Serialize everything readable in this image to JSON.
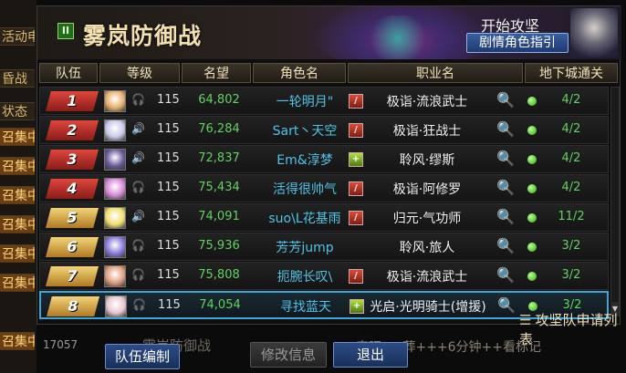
{
  "background": {
    "left_tags": [
      {
        "text": "活动申窗",
        "style": "dark"
      },
      {
        "text": "昏战",
        "style": "dark"
      },
      {
        "text": "状态",
        "style": "dark"
      },
      {
        "text": "召集中",
        "style": "orange"
      },
      {
        "text": "召集中",
        "style": "orange"
      },
      {
        "text": "召集中",
        "style": "orange"
      },
      {
        "text": "召集中",
        "style": "orange"
      },
      {
        "text": "召集中",
        "style": "orange"
      },
      {
        "text": "召集中",
        "style": "orange"
      },
      {
        "text": "召集中",
        "style": "orange"
      }
    ],
    "footer_number": "17057",
    "footer_title": "雾岚防御战",
    "footer_note": "来吧++葬+++6分钟++看标记"
  },
  "window": {
    "title": "雾岚防御战",
    "title_icon": "pause-icon",
    "start_label": "开始攻坚",
    "guide_button": "剧情角色指引"
  },
  "table": {
    "columns": [
      "队伍",
      "等级",
      "名望",
      "角色名",
      "职业名",
      "地下城通关"
    ],
    "rows": [
      {
        "rank": "1",
        "rank_color": "red",
        "avatar_color": "#e8b070",
        "sound": "🎧",
        "level": "115",
        "fame": "64,802",
        "name": "一轮明月\"",
        "class_icon": "warrior",
        "class_name": "极诣·流浪武士",
        "clear": "4/2"
      },
      {
        "rank": "2",
        "rank_color": "red",
        "avatar_color": "#c8c8e8",
        "sound": "🔊",
        "level": "115",
        "fame": "76,284",
        "name": "Sart丶天空",
        "class_icon": "warrior",
        "class_name": "极诣·狂战士",
        "clear": "4/2"
      },
      {
        "rank": "3",
        "rank_color": "red",
        "avatar_color": "#6a5a9a",
        "sound": "🔊",
        "level": "115",
        "fame": "72,837",
        "name": "Em&淳梦",
        "class_icon": "priest",
        "class_name": "聆风·缪斯",
        "clear": "4/2"
      },
      {
        "rank": "4",
        "rank_color": "red",
        "avatar_color": "#d88ad8",
        "sound": "🎧",
        "level": "115",
        "fame": "75,434",
        "name": "活得很帅气",
        "class_icon": "warrior",
        "class_name": "极诣·阿修罗",
        "clear": "4/2"
      },
      {
        "rank": "5",
        "rank_color": "gold",
        "avatar_color": "#f0e070",
        "sound": "🔊",
        "level": "115",
        "fame": "74,091",
        "name": "suo\\L花基雨",
        "class_icon": "warrior",
        "class_name": "归元·气功师",
        "clear": "11/2"
      },
      {
        "rank": "6",
        "rank_color": "gold",
        "avatar_color": "#8a7ad8",
        "sound": "🎧",
        "level": "115",
        "fame": "75,936",
        "name": "芳芳jump",
        "class_icon": "",
        "class_name": "聆风·旅人",
        "clear": "3/2"
      },
      {
        "rank": "7",
        "rank_color": "gold",
        "avatar_color": "#e0a080",
        "sound": "🎧",
        "level": "115",
        "fame": "75,808",
        "name": "扼腕长叹\\",
        "class_icon": "warrior",
        "class_name": "极诣·流浪武士",
        "clear": "3/2"
      },
      {
        "rank": "8",
        "rank_color": "gold",
        "avatar_color": "#e8c8d0",
        "sound": "🎧",
        "level": "115",
        "fame": "74,054",
        "name": "寻找蓝天",
        "class_icon": "priest",
        "class_name": "光启·光明骑士(增援)",
        "clear": "3/2",
        "selected": true
      }
    ]
  },
  "apply_list_label": "攻坚队申请列表",
  "buttons": {
    "team_edit": "队伍编制",
    "modify_info": "修改信息",
    "exit": "退出"
  },
  "colors": {
    "fame": "#5fd35f",
    "name": "#4fc3e8",
    "clear_dot": "#2faa1a",
    "selected_border": "#3aa7d8"
  }
}
